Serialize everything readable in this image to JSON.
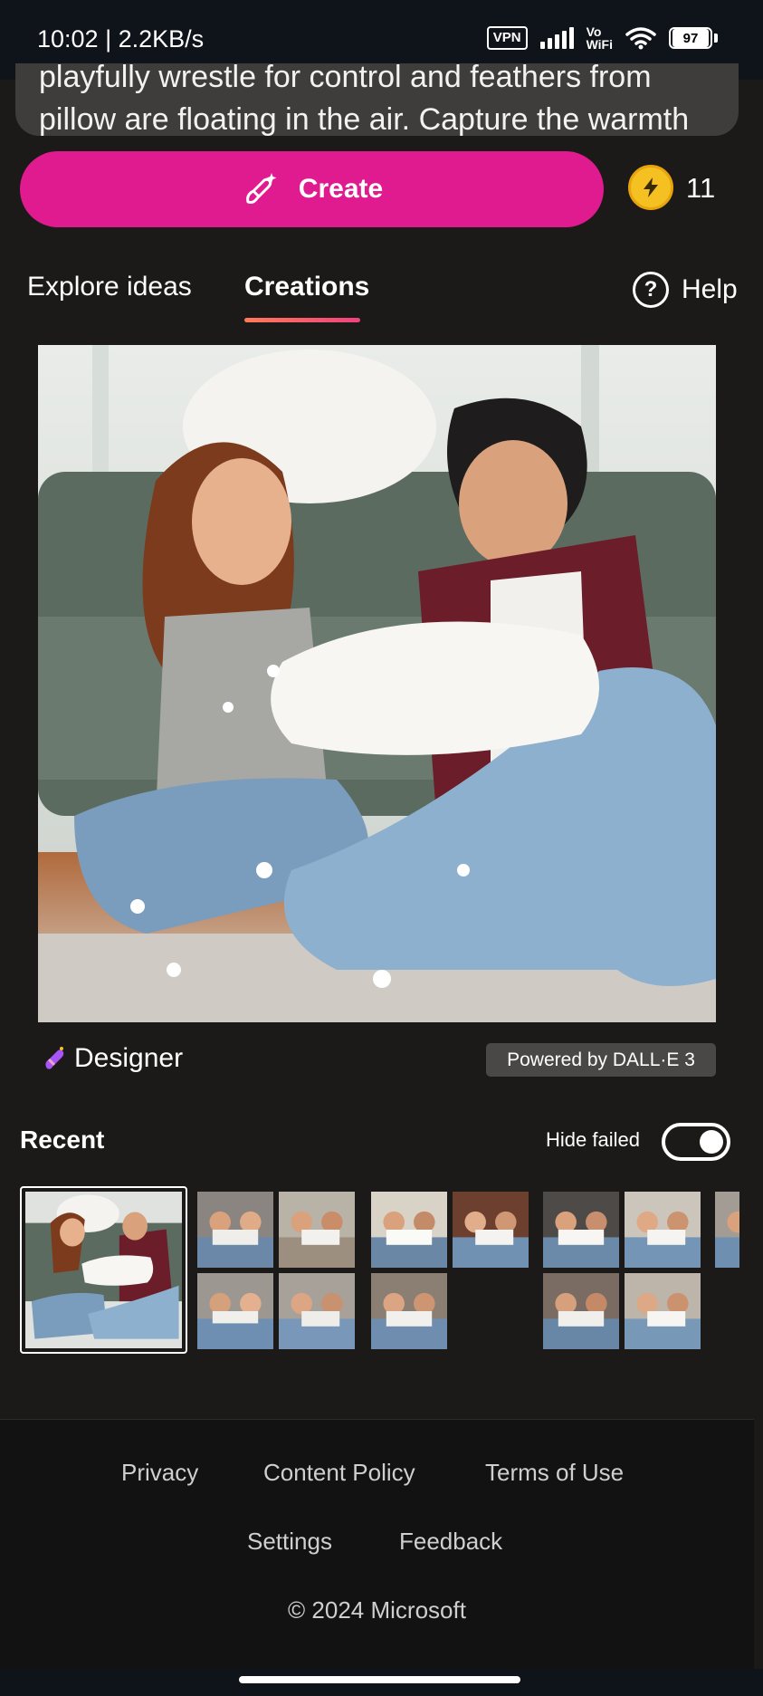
{
  "status_bar": {
    "time": "10:02 | 2.2KB/s",
    "vpn": "VPN",
    "vowifi_top": "Vo",
    "vowifi_bottom": "WiFi",
    "battery": "97"
  },
  "prompt": {
    "text": "playfully wrestle for control and feathers from pillow are floating in the air. Capture the warmth"
  },
  "create": {
    "label": "Create",
    "boost_count": "11",
    "icon": "magic-brush-icon",
    "boost_icon": "lightning-icon"
  },
  "tabs": [
    {
      "label": "Explore ideas",
      "active": false
    },
    {
      "label": "Creations",
      "active": true
    }
  ],
  "help": {
    "label": "Help",
    "icon_glyph": "?"
  },
  "image_caption": {
    "brand": "Designer",
    "powered_by": "Powered by DALL·E 3"
  },
  "recent": {
    "title": "Recent",
    "hide_failed_label": "Hide failed",
    "hide_failed_on": true
  },
  "footer": {
    "links": [
      "Privacy",
      "Content Policy",
      "Terms of Use",
      "Settings",
      "Feedback"
    ],
    "copyright": "© 2024 Microsoft"
  },
  "colors": {
    "accent": "#e01a8f",
    "background": "#1c1a19",
    "coin": "#f5c022"
  }
}
